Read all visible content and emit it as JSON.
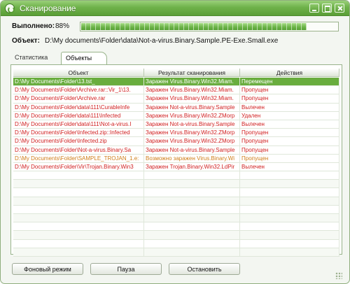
{
  "window": {
    "title": "Сканирование",
    "accent_color": "#6fb24a"
  },
  "progress": {
    "label": "Выполнено:",
    "value_text": "88%",
    "fraction": 0.88
  },
  "current_object": {
    "label": "Объект:",
    "path": "D:\\My documents\\Folder\\data\\Not-a-virus.Binary.Sample.PE-Exe.Small.exe"
  },
  "tabs": [
    {
      "label": "Статистика"
    },
    {
      "label": "Объекты",
      "active": true
    }
  ],
  "table": {
    "headers": [
      "Объект",
      "Результат сканирования",
      "Действия"
    ],
    "rows": [
      {
        "object": "D:\\My Documents\\Folder\\13.tst_",
        "result": "Заражен Virus.Binary.Win32.Miam.",
        "action": "Перемещен",
        "color": "#ffffff",
        "selected": true
      },
      {
        "object": "D:\\My Documents\\Folder\\Archive.rar::Vir_1\\13.",
        "result": "Заражен Virus.Binary.Win32.Miam.",
        "action": "Пропущен",
        "color": "#d01f1f"
      },
      {
        "object": "D:\\My Documents\\Folder\\Archive.rar",
        "result": "Заражен Virus.Binary.Win32.Miam.",
        "action": "Пропущен",
        "color": "#d01f1f"
      },
      {
        "object": "D:\\My Documents\\Folder\\data\\111\\CurableInfe",
        "result": "Заражен Not-a-virus.Binary.Sample",
        "action": "Вылечен",
        "color": "#d01f1f"
      },
      {
        "object": "D:\\My Documents\\Folder\\data\\111\\Infected",
        "result": "Заражен Virus.Binary.Win32.ZMorp",
        "action": "Удален",
        "color": "#d01f1f"
      },
      {
        "object": "D:\\My Documents\\Folder\\data\\111\\Not-a-virus.I",
        "result": "Заражен Not-a-virus.Binary.Sample",
        "action": "Вылечен",
        "color": "#d01f1f"
      },
      {
        "object": "D:\\My Documents\\Folder\\Infected.zip::Infected",
        "result": "Заражен Virus.Binary.Win32.ZMorp",
        "action": "Пропущен",
        "color": "#d01f1f"
      },
      {
        "object": "D:\\My Documents\\Folder\\Infected.zip",
        "result": "Заражен Virus.Binary.Win32.ZMorp",
        "action": "Пропущен",
        "color": "#d01f1f"
      },
      {
        "object": "D:\\My Documents\\Folder\\Not-a-virus.Binary.Sa",
        "result": "Заражен Not-a-virus.Binary.Sample",
        "action": "Пропущен",
        "color": "#d01f1f"
      },
      {
        "object": "D:\\My Documents\\Folder\\SAMPLE_TROJAN_1.e:",
        "result": "Возможно заражен Virus.Binary.Wi",
        "action": "Пропущен",
        "color": "#cf7f1a"
      },
      {
        "object": "D:\\My Documents\\Folder\\Vir\\Trojan.Binary.Win3",
        "result": "Заражен Trojan.Binary.Win32.LdPir",
        "action": "Вылечен",
        "color": "#d01f1f"
      }
    ],
    "selected_row_color": "#69ad3e"
  },
  "buttons": {
    "background": "Фоновый режим",
    "pause": "Пауза",
    "stop": "Остановить"
  }
}
